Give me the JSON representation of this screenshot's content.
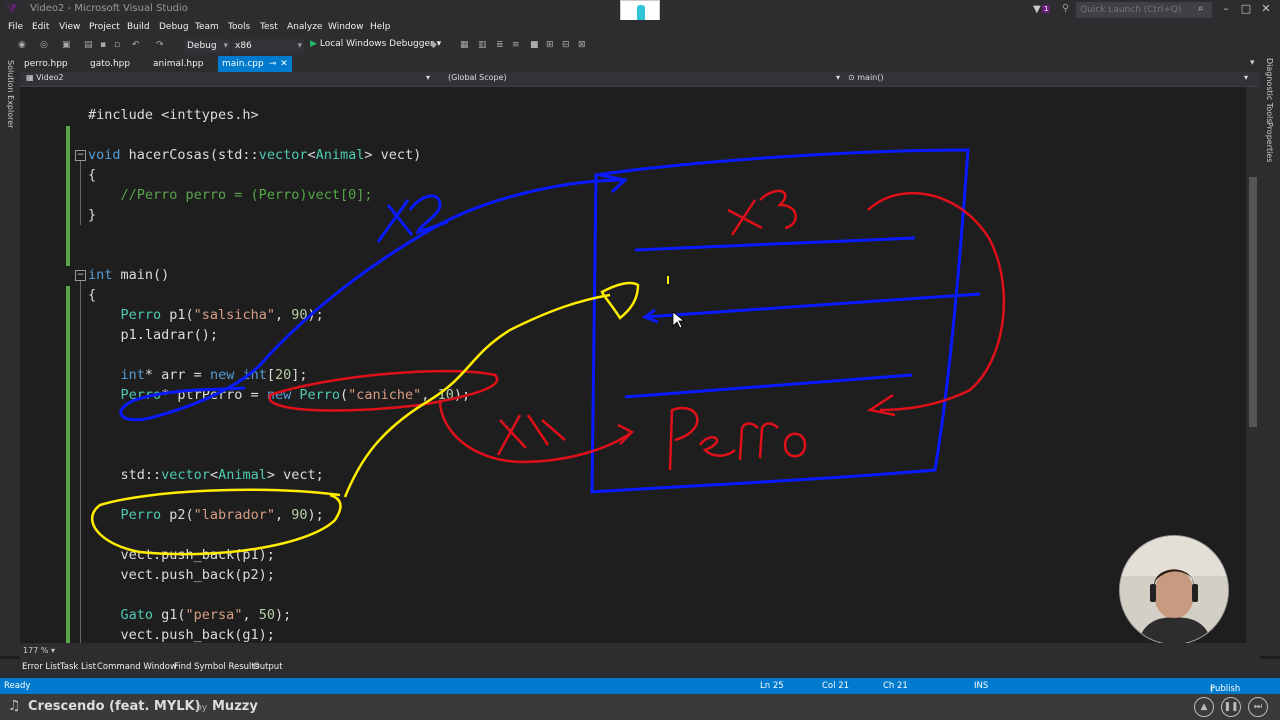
{
  "window": {
    "title": "Video2 - Microsoft Visual Studio",
    "quick_launch_placeholder": "Quick Launch (Ctrl+Q)",
    "notification_count": "1"
  },
  "menu": [
    "File",
    "Edit",
    "View",
    "Project",
    "Build",
    "Debug",
    "Team",
    "Tools",
    "Test",
    "Analyze",
    "Window",
    "Help"
  ],
  "toolbar": {
    "config": "Debug",
    "platform": "x86",
    "run_label": "Local Windows Debugger"
  },
  "side_panels": {
    "left": "Solution Explorer",
    "right_1": "Diagnostic Tools",
    "right_2": "Properties"
  },
  "tabs": [
    {
      "label": "perro.hpp"
    },
    {
      "label": "gato.hpp"
    },
    {
      "label": "animal.hpp"
    },
    {
      "label": "main.cpp"
    }
  ],
  "navbar": {
    "project": "Video2",
    "scope": "(Global Scope)",
    "member": "main()"
  },
  "code": {
    "l1": "#include <inttypes.h>",
    "l3_kw": "void",
    "l3_rest": " hacerCosas(std::",
    "l3_ty1": "vector",
    "l3_lt": "<",
    "l3_ty2": "Animal",
    "l3_end": "> vect)",
    "l4": "{",
    "l5": "    //Perro perro = (Perro)vect[0];",
    "l6": "}",
    "l9_kw": "int",
    "l9_rest": " main()",
    "l10": "{",
    "l11_ty": "    Perro",
    "l11_a": " p1(",
    "l11_s": "\"salsicha\"",
    "l11_c": ", ",
    "l11_n": "90",
    "l11_e": ");",
    "l12": "    p1.ladrar();",
    "l14_kw": "    int",
    "l14_a": "* arr = ",
    "l14_new": "new",
    "l14_sp": " ",
    "l14_int": "int",
    "l14_b": "[",
    "l14_n": "20",
    "l14_e": "];",
    "l15_ty": "    Perro",
    "l15_a": "* ptrPerro = ",
    "l15_new": "new",
    "l15_sp": " ",
    "l15_ty2": "Perro",
    "l15_b": "(",
    "l15_s": "\"caniche\"",
    "l15_c": ", ",
    "l15_n": "10",
    "l15_e": ");",
    "l19_a": "    std::",
    "l19_ty": "vector",
    "l19_lt": "<",
    "l19_ty2": "Animal",
    "l19_e": "> vect;",
    "l21_ty": "    Perro",
    "l21_a": " p2(",
    "l21_s": "\"labrador\"",
    "l21_c": ", ",
    "l21_n": "90",
    "l21_e": ");",
    "l23": "    vect.push_back(p1);",
    "l24": "    vect.push_back(p2);",
    "l26_ty": "    Gato",
    "l26_a": " g1(",
    "l26_s": "\"persa\"",
    "l26_c": ", ",
    "l26_n": "50",
    "l26_e": ");",
    "l27": "    vect.push_back(g1);"
  },
  "zoom": "177 %",
  "bottom_tabs": [
    "Error List",
    "Task List",
    "Command Window",
    "Find Symbol Results",
    "Output"
  ],
  "status": {
    "ready": "Ready",
    "ln": "Ln 25",
    "col": "Col 21",
    "ch": "Ch 21",
    "ins": "INS",
    "publish": "Publish"
  },
  "music": {
    "title": "Crescendo (feat. MYLK)",
    "by": "by",
    "artist": "Muzzy"
  },
  "icons": [
    "vs-logo-icon",
    "filter-icon",
    "search-icon",
    "minimize-icon",
    "maximize-icon",
    "close-icon",
    "play-icon",
    "music-note-icon",
    "prev-icon",
    "pause-icon",
    "next-icon"
  ],
  "colors": {
    "accent": "#007acc",
    "keyword": "#569cd6",
    "type": "#4ec9b0",
    "string": "#d69d85",
    "comment": "#57a64a",
    "annotation_blue": "#0a1aff",
    "annotation_red": "#e0101a",
    "annotation_yellow": "#ffee00"
  }
}
